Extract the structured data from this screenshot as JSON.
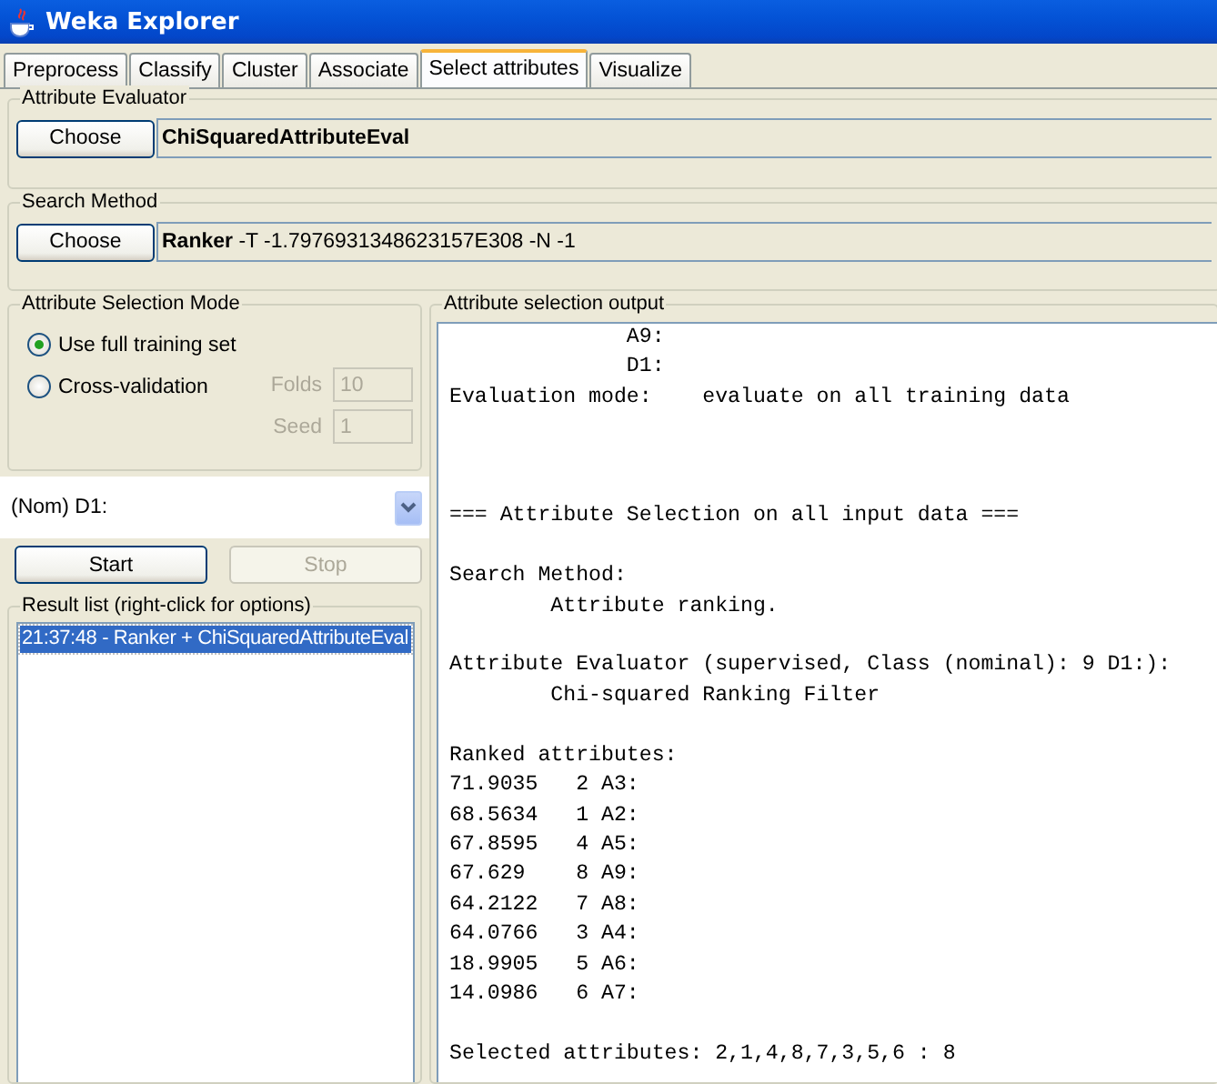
{
  "window": {
    "title": "Weka Explorer"
  },
  "tabs": [
    {
      "label": "Preprocess",
      "selected": false
    },
    {
      "label": "Classify",
      "selected": false
    },
    {
      "label": "Cluster",
      "selected": false
    },
    {
      "label": "Associate",
      "selected": false
    },
    {
      "label": "Select attributes",
      "selected": true
    },
    {
      "label": "Visualize",
      "selected": false
    }
  ],
  "attribute_evaluator": {
    "title": "Attribute Evaluator",
    "button": "Choose",
    "name": "ChiSquaredAttributeEval"
  },
  "search_method": {
    "title": "Search Method",
    "button": "Choose",
    "name": "Ranker",
    "options": "-T -1.7976931348623157E308 -N -1"
  },
  "selection_mode": {
    "title": "Attribute Selection Mode",
    "options": [
      {
        "label": "Use full training set",
        "selected": true
      },
      {
        "label": "Cross-validation",
        "selected": false
      }
    ],
    "fields": [
      {
        "label": "Folds",
        "value": "10",
        "disabled": true
      },
      {
        "label": "Seed",
        "value": "1",
        "disabled": true
      }
    ]
  },
  "class_selector": {
    "value": "(Nom) D1:"
  },
  "buttons": [
    {
      "label": "Start",
      "disabled": false
    },
    {
      "label": "Stop",
      "disabled": true
    }
  ],
  "result_list": {
    "title": "Result list (right-click for options)",
    "items": [
      {
        "label": "21:37:48 - Ranker + ChiSquaredAttributeEval",
        "selected": true
      }
    ]
  },
  "output": {
    "title": "Attribute selection output",
    "text": "              A9:\n              D1:\nEvaluation mode:    evaluate on all training data\n\n\n\n=== Attribute Selection on all input data ===\n\nSearch Method:\n        Attribute ranking.\n\nAttribute Evaluator (supervised, Class (nominal): 9 D1:):\n        Chi-squared Ranking Filter\n\nRanked attributes:\n71.9035   2 A3:\n68.5634   1 A2:\n67.8595   4 A5:\n67.629    8 A9:\n64.2122   7 A8:\n64.0766   3 A4:\n18.9905   5 A6:\n14.0986   6 A7:\n\nSelected attributes: 2,1,4,8,7,3,5,6 : 8"
  }
}
